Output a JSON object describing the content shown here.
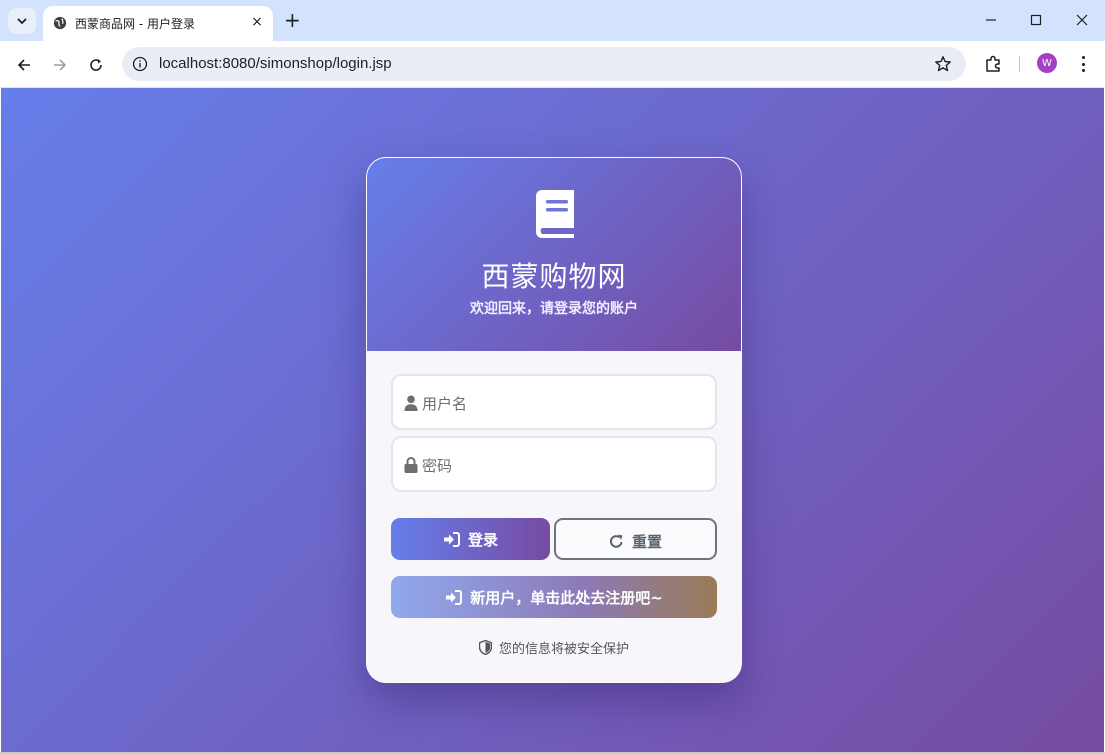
{
  "browser": {
    "tab_title": "西蒙商品网 - 用户登录",
    "tab_close": "×",
    "new_tab": "+",
    "url": "localhost:8080/simonshop/login.jsp",
    "profile_initial": "W"
  },
  "page": {
    "brand_title": "西蒙购物网",
    "brand_subtitle": "欢迎回来，请登录您的账户",
    "username_placeholder": "用户名",
    "password_placeholder": "密码",
    "login_label": "登录",
    "reset_label": "重置",
    "register_label": "新用户，单击此处去注册吧~",
    "security_note": "您的信息将被安全保护"
  },
  "colors": {
    "gradient_start": "#667eea",
    "gradient_end": "#764ba2",
    "reset_border": "#6c757d"
  }
}
